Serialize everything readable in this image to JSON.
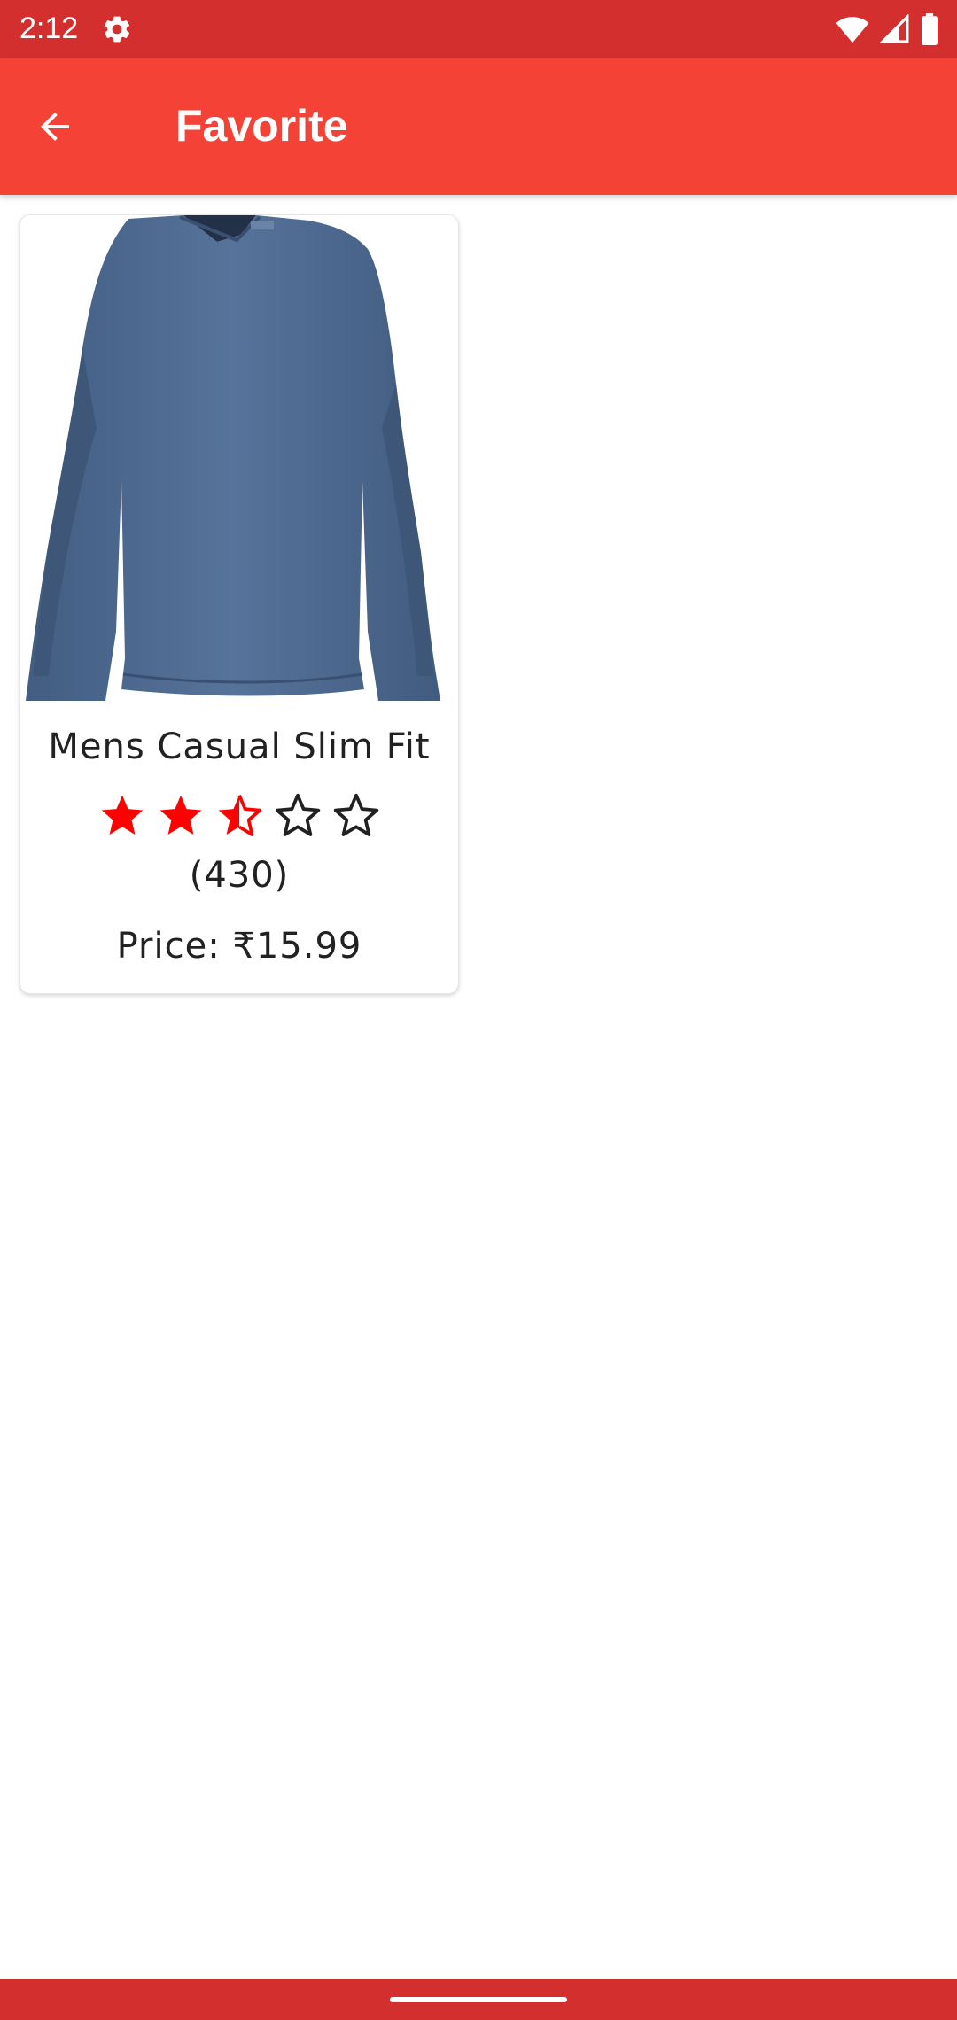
{
  "status_bar": {
    "time": "2:12",
    "icons": [
      "gear-icon",
      "wifi-icon",
      "signal-icon",
      "battery-icon"
    ]
  },
  "app_bar": {
    "title": "Favorite",
    "back_icon": "arrow-back-icon"
  },
  "favorites": [
    {
      "name": "Mens Casual Slim Fit",
      "rating": 2.5,
      "rating_max": 5,
      "rating_count": "(430)",
      "price": "Price: ₹15.99"
    }
  ],
  "colors": {
    "status_bar": "#d32f2f",
    "app_bar": "#f44336",
    "star_filled": "#ff0000",
    "star_empty_outline": "#212121",
    "shirt": "#4f6b91"
  }
}
